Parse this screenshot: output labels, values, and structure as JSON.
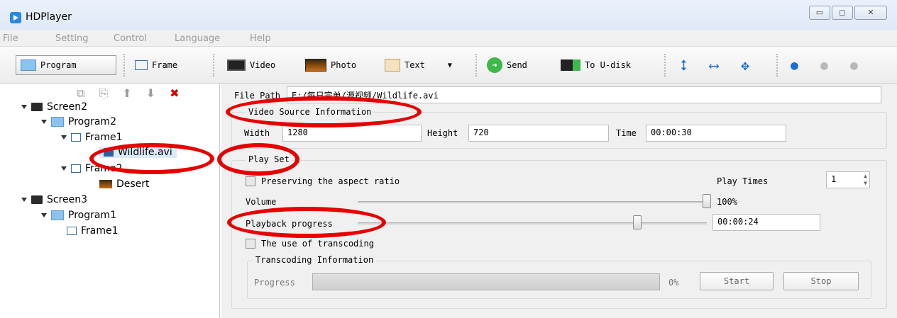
{
  "window": {
    "title": "HDPlayer"
  },
  "menu": [
    "File",
    "Setting",
    "Control",
    "Language",
    "Help"
  ],
  "toolbar": {
    "program": "Program",
    "frame": "Frame",
    "video": "Video",
    "photo": "Photo",
    "text": "Text",
    "send": "Send",
    "to_udisk": "To U-disk"
  },
  "tree": {
    "screen2": "Screen2",
    "program2": "Program2",
    "frame1": "Frame1",
    "wildlife": "Wildlife.avi",
    "frame2": "Frame2",
    "desert": "Desert",
    "screen3": "Screen3",
    "program1": "Program1",
    "frame1b": "Frame1"
  },
  "props": {
    "file_path_label": "File Path",
    "file_path_value": "E:/每日完单/源视频/Wildlife.avi",
    "video_source_title": "Video Source Information",
    "width_label": "Width",
    "width_value": "1280",
    "height_label": "Height",
    "height_value": "720",
    "time_label": "Time",
    "time_value": "00:00:30",
    "play_set_title": "Play Set",
    "preserve_label": "Preserving the aspect ratio",
    "play_times_label": "Play Times",
    "play_times_value": "1",
    "volume_label": "Volume",
    "volume_value": "100%",
    "volume_level": 1.0,
    "playback_label": "Playback progress",
    "playback_time": "00:00:24",
    "playback_level": 0.8,
    "transcoding_label": "The use of transcoding",
    "transcoding_info_title": "Transcoding Information",
    "progress_label": "Progress",
    "progress_value": "0%",
    "start_label": "Start",
    "stop_label": "Stop"
  },
  "colors": {
    "annotation": "#e60000",
    "accent": "#2a88e0"
  }
}
